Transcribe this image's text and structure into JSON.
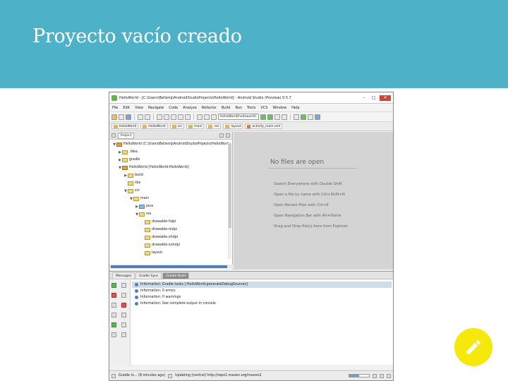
{
  "slide": {
    "title": "Proyecto vacío creado"
  },
  "ide": {
    "window_title": "HelloWorld - [C:\\Users\\Belleriq\\AndroidStudioProjects\\HelloWorld] - Android Studio (Preview) 0.5.7",
    "window_controls": {
      "minimize": "–",
      "maximize": "□",
      "close": "✕"
    },
    "menu": [
      "File",
      "Edit",
      "View",
      "Navigate",
      "Code",
      "Analyze",
      "Refactor",
      "Build",
      "Run",
      "Tools",
      "VCS",
      "Window",
      "Help"
    ],
    "run_config": "HelloWorld[helloworld]",
    "breadcrumbs": [
      "HelloWorld",
      "HelloWorld",
      "src",
      "main",
      "res",
      "layout",
      "activity_main.xml"
    ],
    "project_panel": {
      "view_selector": "Project",
      "tree": [
        {
          "indent": 0,
          "toggle": "▼",
          "icon": "module",
          "label": "HelloWorld (C:\\Users\\Belleriq\\AndroidStudioProjects\\HelloWorld)"
        },
        {
          "indent": 1,
          "toggle": "▶",
          "icon": "folder",
          "label": ".idea"
        },
        {
          "indent": 1,
          "toggle": "▶",
          "icon": "folder",
          "label": "gradle"
        },
        {
          "indent": 1,
          "toggle": "▼",
          "icon": "module",
          "label": "HelloWorld [HelloWorld-HelloWorld]"
        },
        {
          "indent": 2,
          "toggle": "▶",
          "icon": "folder",
          "label": "build"
        },
        {
          "indent": 2,
          "toggle": "",
          "icon": "folder",
          "label": "libs"
        },
        {
          "indent": 2,
          "toggle": "▼",
          "icon": "folder",
          "label": "src"
        },
        {
          "indent": 3,
          "toggle": "▼",
          "icon": "folder",
          "label": "main"
        },
        {
          "indent": 4,
          "toggle": "▶",
          "icon": "blue",
          "label": "java"
        },
        {
          "indent": 4,
          "toggle": "▼",
          "icon": "folder",
          "label": "res"
        },
        {
          "indent": 5,
          "toggle": "",
          "icon": "folder",
          "label": "drawable-hdpi"
        },
        {
          "indent": 5,
          "toggle": "",
          "icon": "folder",
          "label": "drawable-mdpi"
        },
        {
          "indent": 5,
          "toggle": "",
          "icon": "folder",
          "label": "drawable-xhdpi"
        },
        {
          "indent": 5,
          "toggle": "",
          "icon": "folder",
          "label": "drawable-xxhdpi"
        },
        {
          "indent": 5,
          "toggle": "",
          "icon": "folder",
          "label": "layout"
        }
      ]
    },
    "editor": {
      "empty_title": "No files are open",
      "hints": [
        "· Search Everywhere with Double Shift",
        "· Open a file by name with Ctrl+Shift+N",
        "· Open Recent Files with Ctrl+E",
        "· Open Navigation Bar with Alt+Home",
        "· Drag and Drop file(s) here from Explorer"
      ]
    },
    "messages": {
      "tabs": [
        "Messages",
        "Gradle Sync",
        "Gradle Build"
      ],
      "active_tab": 2,
      "rows": [
        "Information: Gradle tasks [:HelloWorld:generateDebugSources]",
        "Information: 0 errors",
        "Information: 0 warnings",
        "Information: See complete output in console"
      ]
    },
    "status": {
      "left": "Gradle in... (8 minutes ago)",
      "middle": "Updating [central] http://repo1.maven.org/maven2",
      "progress": 0.5
    }
  },
  "colors": {
    "header_bg": "#4db1c8",
    "fab_bg": "#f7e80b"
  },
  "icons": {
    "fab": "pencil-icon"
  }
}
